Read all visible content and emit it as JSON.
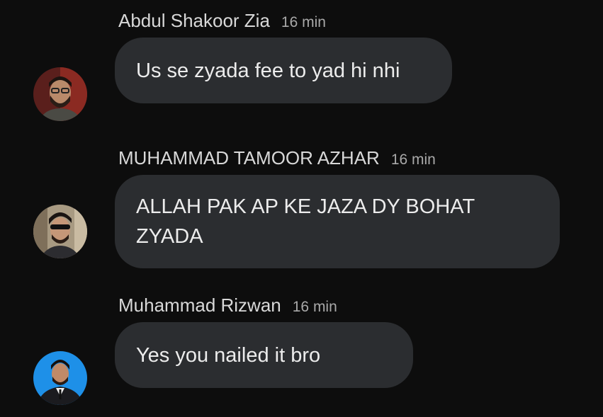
{
  "comments": [
    {
      "author": "Abdul Shakoor Zia",
      "time": "16 min",
      "text": "Us se zyada fee to yad hi nhi",
      "avatar_bg": "#7a2a24"
    },
    {
      "author": "MUHAMMAD TAMOOR AZHAR",
      "time": "16 min",
      "text": "ALLAH PAK AP KE JAZA DY BOHAT ZYADA",
      "avatar_bg": "#8a7a62"
    },
    {
      "author": "Muhammad Rizwan",
      "time": "16 min",
      "text": "Yes you nailed it bro",
      "avatar_bg": "#1e90e8"
    }
  ],
  "colors": {
    "background": "#0d0d0d",
    "bubble": "#2b2d30",
    "author_text": "#d8d8d8",
    "time_text": "#a9a9a9",
    "message_text": "#ececec"
  }
}
